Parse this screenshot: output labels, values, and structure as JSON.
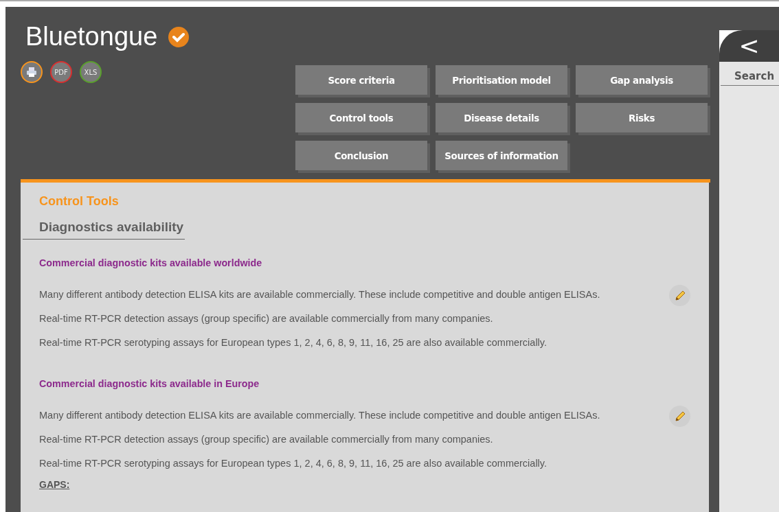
{
  "title": "Bluetongue",
  "verified": true,
  "exports": [
    {
      "kind": "print"
    },
    {
      "kind": "pdf",
      "label": "PDF"
    },
    {
      "kind": "xls",
      "label": "XLS"
    }
  ],
  "nav_buttons": [
    {
      "label": "Score criteria"
    },
    {
      "label": "Prioritisation model"
    },
    {
      "label": "Gap analysis"
    },
    {
      "label": "Control tools"
    },
    {
      "label": "Disease details"
    },
    {
      "label": "Risks"
    },
    {
      "label": "Conclusion"
    },
    {
      "label": "Sources of information"
    }
  ],
  "side_panel": {
    "collapse_label": "<",
    "search_label": "Search"
  },
  "content": {
    "section_title": "Control Tools",
    "subsection_title": "Diagnostics availability",
    "blocks": [
      {
        "heading": "Commercial diagnostic kits available worldwide",
        "editable": true,
        "paragraphs": [
          "Many different antibody detection ELISA kits are available commercially. These include competitive and double antigen ELISAs.",
          "Real-time RT-PCR detection assays (group specific) are available commercially from many companies.",
          "Real-time RT-PCR serotyping assays for European types 1, 2, 4, 6, 8, 9, 11, 16, 25 are also available commercially."
        ]
      },
      {
        "heading": "Commercial diagnostic kits available in Europe",
        "editable": true,
        "paragraphs": [
          "Many different antibody detection ELISA kits are available commercially. These include competitive and double antigen ELISAs.",
          "Real-time RT-PCR detection assays (group specific) are available commercially from many companies.",
          "Real-time RT-PCR serotyping assays for European types 1, 2, 4, 6, 8, 9, 11, 16, 25 are also available commercially."
        ],
        "gaps_label": "GAPS:"
      }
    ]
  }
}
